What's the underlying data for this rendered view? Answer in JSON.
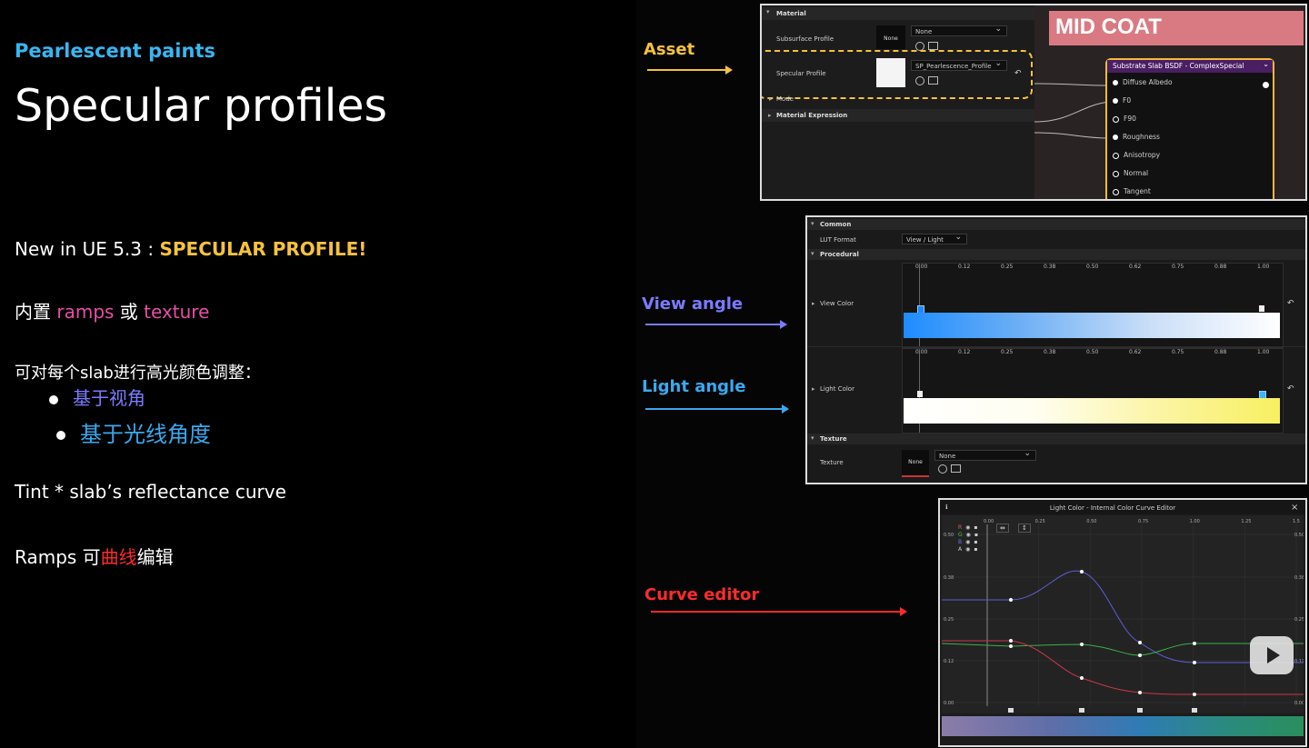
{
  "left": {
    "eyebrow": "Pearlescent paints",
    "title": "Specular profiles",
    "line1_prefix": "New in UE 5.3 : ",
    "line1_highlight": "SPECULAR PROFILE!",
    "line2_a": "内置 ",
    "line2_b": "ramps",
    "line2_c": " 或 ",
    "line2_d": "texture",
    "line3": "可对每个slab进行高光颜色调整：",
    "bullet1": "基于视角",
    "bullet2": "基于光线角度",
    "line4": "Tint * slab’s reflectance curve",
    "line5_a": "Ramps 可",
    "line5_b": "曲线",
    "line5_c": "编辑"
  },
  "callouts": {
    "asset": "Asset",
    "view_angle": "View angle",
    "light_angle": "Light angle",
    "curve_editor": "Curve editor"
  },
  "material_panel": {
    "section_material": "Material",
    "subsurface_label": "Subsurface Profile",
    "subsurface_thumb": "None",
    "subsurface_value": "None",
    "specular_label": "Specular Profile",
    "specular_value": "SP_Pearlescence_Profile",
    "mode_label": "Mode",
    "material_expression": "Material Expression",
    "node_header": "MID COAT",
    "node_title": "Substrate Slab BSDF - ComplexSpecial",
    "pins": [
      "Diffuse Albedo",
      "F0",
      "F90",
      "Roughness",
      "Anisotropy",
      "Normal",
      "Tangent"
    ]
  },
  "profile_panel": {
    "common": "Common",
    "lut_label": "LUT Format",
    "lut_value": "View / Light",
    "procedural": "Procedural",
    "view_color": "View Color",
    "light_color": "Light Color",
    "ticks": [
      "0.00",
      "0.12",
      "0.25",
      "0.38",
      "0.50",
      "0.62",
      "0.75",
      "0.88",
      "1.00"
    ],
    "texture_section": "Texture",
    "texture_label": "Texture",
    "texture_thumb": "None",
    "texture_value": "None"
  },
  "curve_panel": {
    "title": "Light Color - Internal Color Curve Editor",
    "channels": [
      "R",
      "G",
      "B",
      "A"
    ],
    "x_ticks": [
      "0.00",
      "0.25",
      "0.50",
      "0.75",
      "1.00",
      "1.25",
      "1.5"
    ],
    "y_ticks": [
      "0.50",
      "0.38",
      "0.25",
      "0.12",
      "0.00"
    ],
    "colors": {
      "red": "#c8374a",
      "green": "#3cb04a",
      "blue": "#5b5fd6"
    }
  },
  "colors": {
    "asset": "#f6c23e",
    "view_angle": "#7b7bff",
    "light_angle": "#3aa9ef",
    "curve_editor": "#ff2b2b"
  }
}
